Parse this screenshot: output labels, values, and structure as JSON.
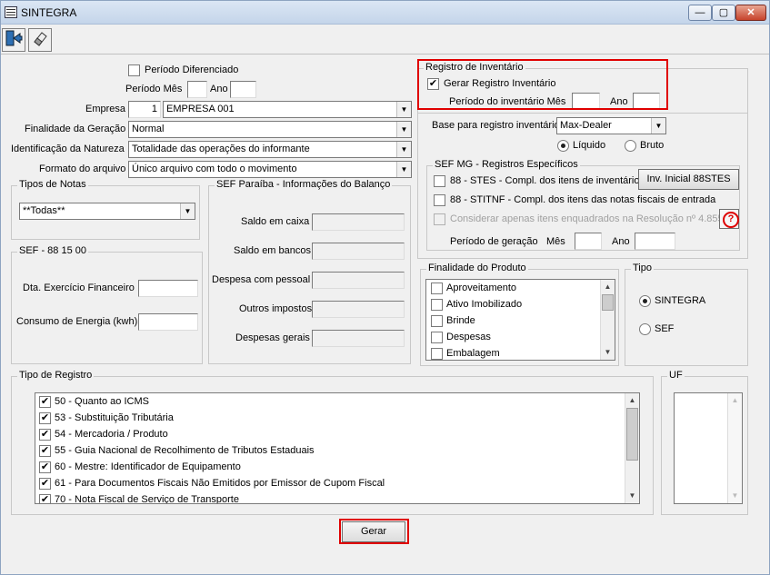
{
  "window": {
    "title": "SINTEGRA",
    "min": "—",
    "max": "▢",
    "close": "✕"
  },
  "toolbar": {
    "exit_icon": "exit-door-icon",
    "eraser_icon": "eraser-icon"
  },
  "periodo": {
    "diferenciado_label": "Período Diferenciado",
    "mes_label": "Período Mês",
    "ano_label": "Ano",
    "mes_value": "",
    "ano_value": ""
  },
  "empresa": {
    "label": "Empresa",
    "code": "1",
    "name": "EMPRESA 001"
  },
  "finalidade_geracao": {
    "label": "Finalidade da Geração",
    "value": "Normal"
  },
  "natureza": {
    "label": "Identificação da Natureza",
    "value": "Totalidade das operações do informante"
  },
  "formato": {
    "label": "Formato do arquivo",
    "value": "Único arquivo com todo o movimento"
  },
  "tipos_notas": {
    "title": "Tipos de Notas",
    "value": "**Todas**"
  },
  "sef_88": {
    "title": "SEF - 88 15 00",
    "exercicio_label": "Dta. Exercício Financeiro",
    "energia_label": "Consumo de Energia (kwh)",
    "exercicio_value": "",
    "energia_value": ""
  },
  "paraiba": {
    "title": "SEF Paraíba - Informações do Balanço",
    "fields": [
      {
        "label": "Saldo em caixa"
      },
      {
        "label": "Saldo em bancos"
      },
      {
        "label": "Despesa com pessoal"
      },
      {
        "label": "Outros impostos"
      },
      {
        "label": "Despesas gerais"
      }
    ]
  },
  "inventario": {
    "title": "Registro de Inventário",
    "gerar_label": "Gerar Registro Inventário",
    "gerar_checked": "✔",
    "periodo_label": "Período do inventário Mês",
    "ano_label": "Ano",
    "base_label": "Base para registro inventário",
    "base_value": "Max-Dealer",
    "liquido_label": "Líquido",
    "bruto_label": "Bruto"
  },
  "sef_mg": {
    "title": "SEF MG - Registros Específicos",
    "item1": "88 - STES - Compl. dos itens de inventário",
    "item1_button": "Inv. Inicial 88STES",
    "item2": "88 - STITNF - Compl. dos itens das notas fiscais de entrada",
    "item3": "Considerar apenas itens enquadrados na Resolução nº 4.855",
    "periodo_label": "Período de geração",
    "mes_label": "Mês",
    "ano_label": "Ano"
  },
  "finalidade_produto": {
    "title": "Finalidade do Produto",
    "items": [
      "Aproveitamento",
      "Ativo Imobilizado",
      "Brinde",
      "Despesas",
      "Embalagem"
    ]
  },
  "tipo": {
    "title": "Tipo",
    "sintegra": "SINTEGRA",
    "sef": "SEF"
  },
  "tipo_registro": {
    "title": "Tipo de Registro",
    "items": [
      "50 - Quanto ao ICMS",
      "53 - Substituição Tributária",
      "54 - Mercadoria / Produto",
      "55 - Guia Nacional de Recolhimento de Tributos Estaduais",
      "60 - Mestre: Identificador de Equipamento",
      "61 - Para Documentos Fiscais Não Emitidos por Emissor de Cupom Fiscal",
      "70 - Nota Fiscal de Serviço de Transporte"
    ],
    "check": "✔"
  },
  "uf": {
    "title": "UF"
  },
  "gerar_button": "Gerar"
}
